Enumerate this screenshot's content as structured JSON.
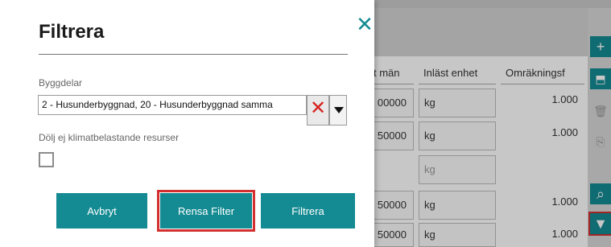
{
  "background": {
    "table": {
      "headers": [
        "t män",
        "Inläst enhet",
        "Omräkningsf"
      ],
      "rows": [
        {
          "col1": "00000",
          "unit": "kg",
          "factor": "1.000"
        },
        {
          "col1": "50000",
          "unit": "kg",
          "factor": "1.000"
        },
        {
          "col1": "",
          "unit": "kg",
          "factor": ""
        },
        {
          "col1": "50000",
          "unit": "kg",
          "factor": "1.000"
        },
        {
          "col1": "50000",
          "unit": "kg",
          "factor": "1.000"
        }
      ]
    },
    "sidebar": {
      "add_icon": "+",
      "folder_icon": "⬒",
      "trash_icon": "🗑",
      "copy_icon": "⎘",
      "search_icon": "⌕",
      "filter_icon": "▼"
    }
  },
  "modal": {
    "title": "Filtrera",
    "close_icon": "✕",
    "building_parts": {
      "label": "Byggdelar",
      "value": "2 - Husunderbyggnad, 20 - Husunderbyggnad samma",
      "clear_icon": "✕"
    },
    "hide_non_climate": {
      "label": "Dölj ej klimatbelastande resurser",
      "checked": false
    },
    "buttons": {
      "cancel": "Avbryt",
      "reset": "Rensa Filter",
      "apply": "Filtrera"
    }
  },
  "colors": {
    "accent": "#148b92",
    "highlight": "#d32f2f"
  }
}
